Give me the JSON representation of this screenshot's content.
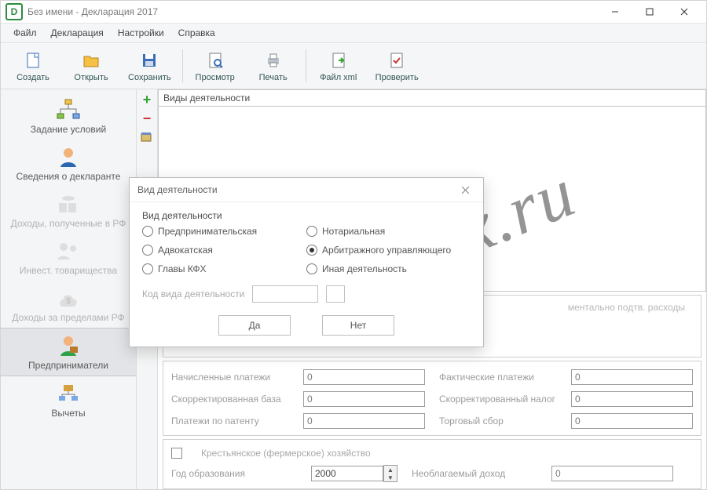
{
  "title": "Без имени - Декларация 2017",
  "menu": [
    "Файл",
    "Декларация",
    "Настройки",
    "Справка"
  ],
  "toolbar": [
    {
      "k": "create",
      "label": "Создать"
    },
    {
      "k": "open",
      "label": "Открыть"
    },
    {
      "k": "save",
      "label": "Сохранить"
    },
    {
      "k": "sep"
    },
    {
      "k": "view",
      "label": "Просмотр"
    },
    {
      "k": "print",
      "label": "Печать"
    },
    {
      "k": "sep"
    },
    {
      "k": "xml",
      "label": "Файл xml"
    },
    {
      "k": "check",
      "label": "Проверить"
    }
  ],
  "sidebar": [
    {
      "k": "conditions",
      "label": "Задание условий",
      "dim": false
    },
    {
      "k": "declarant",
      "label": "Сведения о декларанте",
      "dim": false
    },
    {
      "k": "income-rf",
      "label": "Доходы, полученные в РФ",
      "dim": true
    },
    {
      "k": "invest",
      "label": "Инвест. товарищества",
      "dim": true
    },
    {
      "k": "income-abroad",
      "label": "Доходы за пределами РФ",
      "dim": true
    },
    {
      "k": "entrepreneur",
      "label": "Предприниматели",
      "dim": false,
      "selected": true
    },
    {
      "k": "deductions",
      "label": "Вычеты",
      "dim": false
    }
  ],
  "list_header": "Виды деятельности",
  "hidden_group": {
    "expense_hint": "ментально подтв. расходы"
  },
  "fields": {
    "accrued_label": "Начисленные платежи",
    "accrued_val": "0",
    "actual_label": "Фактические платежи",
    "actual_val": "0",
    "corr_base_label": "Скорректированная база",
    "corr_base_val": "0",
    "corr_tax_label": "Скорректированный налог",
    "corr_tax_val": "0",
    "patent_label": "Платежи по патенту",
    "patent_val": "0",
    "trade_fee_label": "Торговый сбор",
    "trade_fee_val": "0",
    "farm_label": "Крестьянское (фермерское) хозяйство",
    "year_label": "Год образования",
    "year_val": "2000",
    "untaxed_label": "Необлагаемый доход",
    "untaxed_val": "0"
  },
  "modal": {
    "title": "Вид деятельности",
    "group_title": "Вид деятельности",
    "radios_left": [
      {
        "k": "business",
        "label": "Предпринимательская"
      },
      {
        "k": "lawyer",
        "label": "Адвокатская"
      },
      {
        "k": "kfh",
        "label": "Главы КФХ"
      }
    ],
    "radios_right": [
      {
        "k": "notary",
        "label": "Нотариальная"
      },
      {
        "k": "arbitration",
        "label": "Арбитражного управляющего",
        "checked": true
      },
      {
        "k": "other",
        "label": "Иная деятельность"
      }
    ],
    "code_label": "Код вида деятельности",
    "yes": "Да",
    "no": "Нет"
  },
  "watermark": "nalogbox.ru"
}
